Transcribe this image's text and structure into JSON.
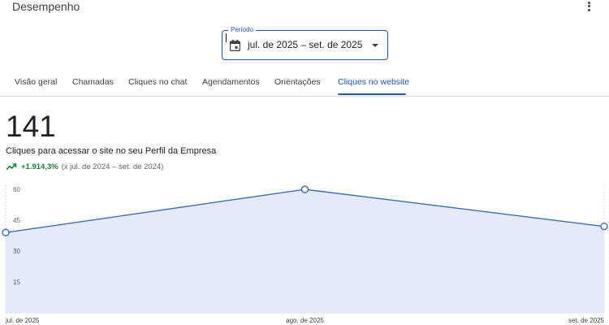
{
  "header": {
    "title": "Desempenho"
  },
  "period": {
    "label": "Período",
    "value": "jul. de 2025 – set. de 2025"
  },
  "tabs": [
    {
      "label": "Visão geral",
      "active": false
    },
    {
      "label": "Chamadas",
      "active": false
    },
    {
      "label": "Cliques no chat",
      "active": false
    },
    {
      "label": "Agendamentos",
      "active": false
    },
    {
      "label": "Orientações",
      "active": false
    },
    {
      "label": "Cliques no website",
      "active": true
    }
  ],
  "metric": {
    "value": "141",
    "description": "Cliques para acessar o site no seu Perfil da Empresa",
    "change": "+1.914,3%",
    "comparison": "(x jul. de 2024 – set. de 2024)"
  },
  "colors": {
    "accent": "#1a56c5",
    "positive": "#188038",
    "area_fill": "#e3ebfb",
    "line": "#3d6cb9"
  },
  "chart_data": {
    "type": "area",
    "categories": [
      "jul. de 2025",
      "ago. de 2025",
      "set. de 2025"
    ],
    "values": [
      39,
      60,
      42
    ],
    "yticks": [
      15,
      30,
      45,
      60
    ],
    "ylim": [
      0,
      62
    ],
    "grid": true
  }
}
